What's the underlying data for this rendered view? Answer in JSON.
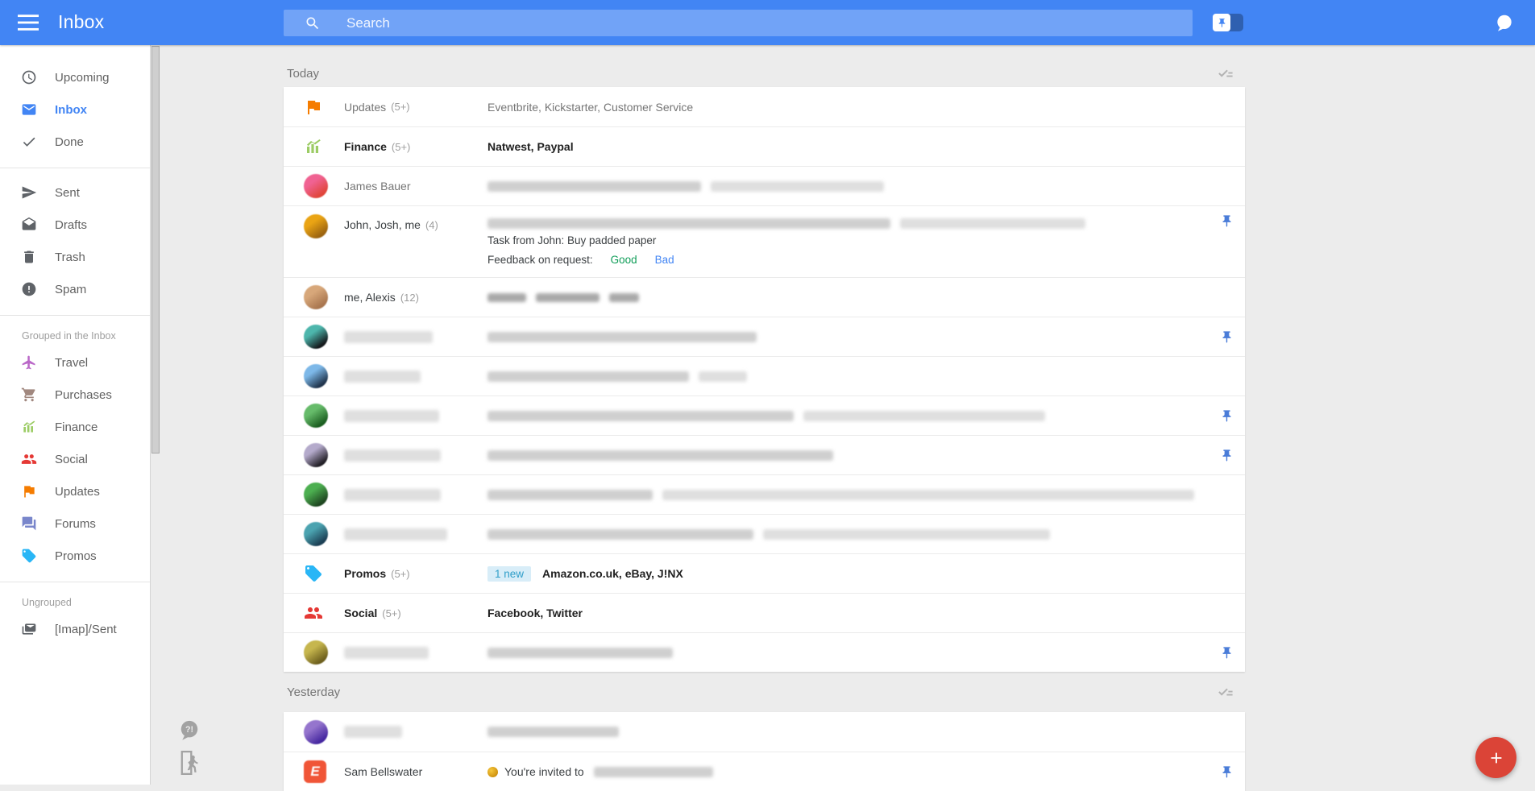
{
  "topbar": {
    "title": "Inbox",
    "search_placeholder": "Search",
    "pin_toggle_on": false
  },
  "colors": {
    "topbar": "#4285f4",
    "accent": "#4285f4",
    "fab": "#db4437",
    "badge_bg": "#d8edf8",
    "badge_text": "#2f9ec9",
    "good_link": "#0f9d58",
    "bad_link": "#4285f4",
    "pin": "#4a7cd8"
  },
  "sidebar": {
    "sections": [
      {
        "items": [
          {
            "id": "upcoming",
            "label": "Upcoming",
            "icon": "clock"
          },
          {
            "id": "inbox",
            "label": "Inbox",
            "icon": "inbox",
            "active": true
          },
          {
            "id": "done",
            "label": "Done",
            "icon": "check"
          }
        ]
      },
      {
        "items": [
          {
            "id": "sent",
            "label": "Sent",
            "icon": "send"
          },
          {
            "id": "drafts",
            "label": "Drafts",
            "icon": "drafts"
          },
          {
            "id": "trash",
            "label": "Trash",
            "icon": "trash"
          },
          {
            "id": "spam",
            "label": "Spam",
            "icon": "spam"
          }
        ]
      },
      {
        "label": "Grouped in the Inbox",
        "items": [
          {
            "id": "travel",
            "label": "Travel",
            "icon": "flight",
            "color": "#ba68c8"
          },
          {
            "id": "purchases",
            "label": "Purchases",
            "icon": "cart",
            "color": "#a1887f"
          },
          {
            "id": "finance",
            "label": "Finance",
            "icon": "chart",
            "color": "#9ccc65"
          },
          {
            "id": "social",
            "label": "Social",
            "icon": "people",
            "color": "#e53935"
          },
          {
            "id": "updates",
            "label": "Updates",
            "icon": "flag",
            "color": "#f57c00"
          },
          {
            "id": "forums",
            "label": "Forums",
            "icon": "forum",
            "color": "#7986cb"
          },
          {
            "id": "promos",
            "label": "Promos",
            "icon": "tag",
            "color": "#29b6f6"
          }
        ]
      },
      {
        "label": "Ungrouped",
        "items": [
          {
            "id": "imap-sent",
            "label": "[Imap]/Sent",
            "icon": "mail2"
          }
        ]
      }
    ]
  },
  "list": {
    "sections": [
      {
        "id": "today",
        "label": "Today",
        "rows": [
          {
            "kind": "bundle",
            "icon": "flag",
            "icon_color": "#f57c00",
            "sender": "Updates",
            "count": "(5+)",
            "unread": false,
            "subject": "Eventbrite, Kickstarter, Customer Service",
            "pinned": false
          },
          {
            "kind": "bundle",
            "icon": "chart",
            "icon_color": "#9ccc65",
            "sender": "Finance",
            "count": "(5+)",
            "unread": true,
            "subject": "Natwest, Paypal",
            "pinned": false
          },
          {
            "kind": "person",
            "avatar_colors": [
              "#f06292",
              "#e0453a"
            ],
            "sender": "James Bauer",
            "sender_tone": "read",
            "subject_blurs": [
              [
                265,
                "b"
              ],
              [
                215,
                "a"
              ]
            ],
            "pinned": false
          },
          {
            "kind": "person",
            "avatar_colors": [
              "#eaa414",
              "#9c6410"
            ],
            "sender": "John, Josh, me",
            "count": "(4)",
            "sender_tone": "dark",
            "subject_blurs": [
              [
                500,
                "b"
              ],
              [
                230,
                "a"
              ]
            ],
            "pinned": true,
            "task": {
              "line1": "Task from John: Buy padded paper",
              "line2_label": "Feedback on request:",
              "good": "Good",
              "bad": "Bad"
            }
          },
          {
            "kind": "person",
            "avatar_colors": [
              "#d7a77a",
              "#a9764f"
            ],
            "sender": "me, Alexis",
            "count": "(12)",
            "sender_tone": "dark",
            "subject_blurs": [
              [
                48,
                "c"
              ],
              [
                79,
                "c"
              ],
              [
                37,
                "c"
              ]
            ],
            "pinned": false
          },
          {
            "kind": "blurred",
            "avatar_colors": [
              "#4db6ac",
              "#15191c"
            ],
            "name_blur": 110,
            "subject_blurs": [
              [
                334,
                "b"
              ]
            ],
            "pinned": true
          },
          {
            "kind": "blurred",
            "avatar_colors": [
              "#7db8e8",
              "#20344c"
            ],
            "name_blur": 95,
            "subject_blurs": [
              [
                250,
                "b"
              ],
              [
                60,
                "a"
              ]
            ],
            "pinned": false
          },
          {
            "kind": "blurred",
            "avatar_colors": [
              "#66bb6a",
              "#1b5e20"
            ],
            "name_blur": 118,
            "subject_blurs": [
              [
                380,
                "b"
              ],
              [
                300,
                "a"
              ]
            ],
            "pinned": true
          },
          {
            "kind": "blurred",
            "avatar_colors": [
              "#b4aacb",
              "#221f26"
            ],
            "name_blur": 120,
            "subject_blurs": [
              [
                429,
                "b"
              ]
            ],
            "pinned": true
          },
          {
            "kind": "blurred",
            "avatar_colors": [
              "#4caf50",
              "#1e4620"
            ],
            "name_blur": 120,
            "subject_blurs": [
              [
                205,
                "b"
              ],
              [
                660,
                "a"
              ]
            ],
            "pinned": false
          },
          {
            "kind": "blurred",
            "avatar_colors": [
              "#4ba3b0",
              "#1c3f54"
            ],
            "name_blur": 128,
            "subject_blurs": [
              [
                330,
                "b"
              ],
              [
                356,
                "a"
              ]
            ],
            "pinned": false
          },
          {
            "kind": "bundle",
            "icon": "tag",
            "icon_color": "#29b6f6",
            "sender": "Promos",
            "count": "(5+)",
            "unread": true,
            "badge": "1 new",
            "subject": "Amazon.co.uk, eBay, J!NX",
            "pinned": false
          },
          {
            "kind": "bundle",
            "icon": "people",
            "icon_color": "#e53935",
            "sender": "Social",
            "count": "(5+)",
            "unread": true,
            "subject": "Facebook, Twitter",
            "pinned": false
          },
          {
            "kind": "blurred",
            "avatar_colors": [
              "#c6b64e",
              "#6d5f1d"
            ],
            "name_blur": 105,
            "subject_blurs": [
              [
                230,
                "b"
              ]
            ],
            "pinned": true
          }
        ]
      },
      {
        "id": "yesterday",
        "label": "Yesterday",
        "rows": [
          {
            "kind": "blurred",
            "avatar_colors": [
              "#9575cd",
              "#4527a0"
            ],
            "name_blur": 72,
            "subject_blurs": [
              [
                163,
                "b"
              ]
            ],
            "pinned": false
          },
          {
            "kind": "person",
            "logo": {
              "bg": "#f05537",
              "letter": "E"
            },
            "sender": "Sam Bellswater",
            "sender_tone": "dark",
            "invite_icon": true,
            "subject": "You're invited to",
            "subject_tone": "read",
            "subject_blurs": [
              [
                148,
                "b"
              ]
            ],
            "pinned": true
          }
        ]
      }
    ]
  },
  "fab": {
    "label": "compose"
  },
  "corner_icons": [
    {
      "id": "help-chat",
      "glyph": "?!"
    },
    {
      "id": "exit"
    }
  ]
}
